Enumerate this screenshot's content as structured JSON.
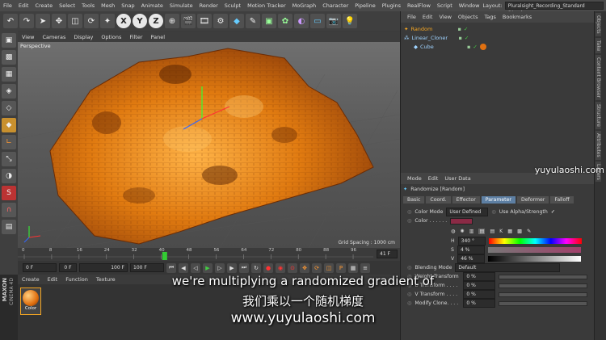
{
  "menubar": {
    "items": [
      "File",
      "Edit",
      "Create",
      "Select",
      "Tools",
      "Mesh",
      "Snap",
      "Animate",
      "Simulate",
      "Render",
      "Sculpt",
      "Motion Tracker",
      "MoGraph",
      "Character",
      "Pipeline",
      "Plugins",
      "RealFlow",
      "Script",
      "Window"
    ],
    "layout_label": "Layout:",
    "layout_value": "Pluralsight_Recording_Standard (User)"
  },
  "toolbar": {
    "x": "X",
    "y": "Y",
    "z": "Z"
  },
  "viewport": {
    "menu": [
      "View",
      "Cameras",
      "Display",
      "Options",
      "Filter",
      "Panel"
    ],
    "label": "Perspective",
    "grid_spacing": "Grid Spacing : 1000 cm"
  },
  "timeline": {
    "ticks": [
      "0",
      "8",
      "16",
      "24",
      "32",
      "40",
      "48",
      "56",
      "64",
      "72",
      "80",
      "88",
      "96"
    ],
    "current_frame": "41",
    "end_label": "41 F"
  },
  "transport": {
    "start": "0 F",
    "min": "0 F",
    "max": "100 F",
    "end": "100 F"
  },
  "material": {
    "menu": [
      "Create",
      "Edit",
      "Function",
      "Texture"
    ],
    "swatch_label": "Color"
  },
  "logo": {
    "line1": "MAXON",
    "line2": "CINEMA 4D"
  },
  "objects": {
    "menu": [
      "File",
      "Edit",
      "View",
      "Objects",
      "Tags",
      "Bookmarks"
    ],
    "rows": [
      {
        "name": "Random",
        "color": "#f5a623"
      },
      {
        "name": "Linear_Cloner",
        "color": "#9fd3ff"
      },
      {
        "name": "Cube",
        "color": "#9fd3ff"
      }
    ]
  },
  "attributes": {
    "menu": [
      "Mode",
      "Edit",
      "User Data"
    ],
    "title": "Randomize [Random]",
    "tabs": [
      "Basic",
      "Coord.",
      "Effector",
      "Parameter",
      "Deformer",
      "Falloff"
    ],
    "active_tab": "Parameter",
    "color_mode_label": "Color Mode",
    "color_mode_value": "User Defined",
    "use_alpha_label": "Use Alpha/Strength",
    "color_label": "Color . . . . . .",
    "h_label": "H",
    "h_value": "340 °",
    "s_label": "S",
    "s_value": "4 %",
    "v_label": "V",
    "v_value": "46 %",
    "blending_mode_label": "Blending Mode",
    "blending_mode_value": "Default",
    "params": [
      {
        "label": "Weight Transform",
        "value": "0 %"
      },
      {
        "label": "U Transform . . . .",
        "value": "0 %"
      },
      {
        "label": "V Transform . . . .",
        "value": "0 %"
      },
      {
        "label": "Modify Clone. . . .",
        "value": "0 %"
      }
    ]
  },
  "side_tabs": [
    "Objects",
    "Take",
    "Content Browser",
    "Structure",
    "Attributes",
    "Layers"
  ],
  "watermarks": {
    "top_right": "yuyulaoshi.com",
    "bottom": "www.yuyulaoshi.com"
  },
  "subtitles": {
    "english": "we're multiplying a randomized gradient of",
    "chinese": "我们乘以一个随机梯度"
  }
}
